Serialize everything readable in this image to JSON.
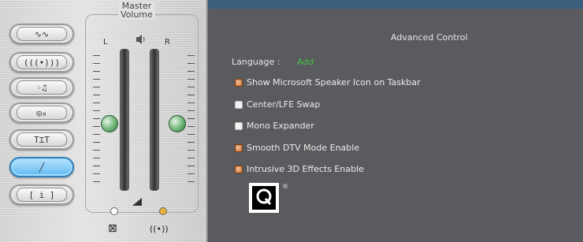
{
  "left": {
    "master_title": "Master",
    "master_subtitle": "Volume",
    "left_channel": "L",
    "right_channel": "R",
    "mode_buttons": [
      {
        "icon": "waveform-icon",
        "label": "∿∿"
      },
      {
        "icon": "ear-icon",
        "label": "(((•)))"
      },
      {
        "icon": "equalizer-icon",
        "label": "◦♫"
      },
      {
        "icon": "microphone-icon",
        "label": "◎₀"
      },
      {
        "icon": "phone-icon",
        "label": "T⌶T"
      },
      {
        "icon": "line-icon",
        "label": "╱"
      },
      {
        "icon": "info-icon",
        "label": "[ i ]"
      }
    ],
    "mute_icon_label": "⊠",
    "surround_icon_label": "((•))"
  },
  "right": {
    "title": "Advanced Control",
    "language_label": "Language :",
    "language_value": "Add",
    "options": [
      {
        "label": "Show Microsoft Speaker Icon on Taskbar",
        "checked": true
      },
      {
        "label": "Center/LFE Swap",
        "checked": false
      },
      {
        "label": "Mono Expander",
        "checked": false
      },
      {
        "label": "Smooth DTV Mode Enable",
        "checked": true
      },
      {
        "label": "Intrusive 3D Effects Enable",
        "checked": true
      }
    ],
    "reg_mark": "®"
  },
  "colors": {
    "accent": "#44c244",
    "panel": "#5a5b5e",
    "active_button": "#5fb9f0",
    "knob": "#6fb476"
  }
}
